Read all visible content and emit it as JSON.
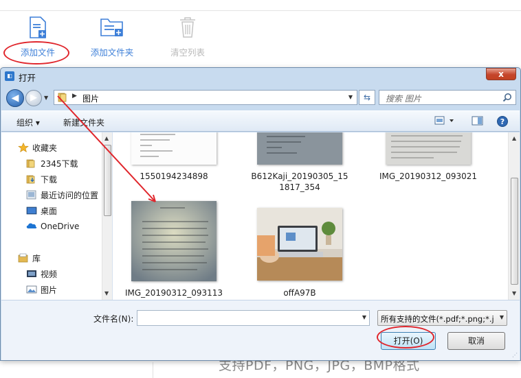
{
  "app": {
    "toolbar": [
      {
        "label": "添加文件",
        "icon": "add-file-icon",
        "enabled": true
      },
      {
        "label": "添加文件夹",
        "icon": "add-folder-icon",
        "enabled": true
      },
      {
        "label": "清空列表",
        "icon": "trash-icon",
        "enabled": false
      }
    ],
    "support_text": "支持PDF，PNG，JPG，BMP格式"
  },
  "dialog": {
    "title": "打开",
    "close_label": "x",
    "breadcrumb": "图片",
    "search_placeholder": "搜索 图片",
    "commands": {
      "organize": "组织 ▾",
      "new_folder": "新建文件夹"
    },
    "nav": {
      "favorites_label": "收藏夹",
      "favorites": [
        "2345下载",
        "下载",
        "最近访问的位置",
        "桌面",
        "OneDrive"
      ],
      "libraries_label": "库",
      "libraries": [
        "视频",
        "图片"
      ]
    },
    "files": [
      {
        "name": "1550194234898"
      },
      {
        "name": "B612Kaji_20190305_15",
        "name2": "1817_354"
      },
      {
        "name": "IMG_20190312_093021"
      },
      {
        "name": "IMG_20190312_093113"
      },
      {
        "name": "offA97B"
      }
    ],
    "filename_label": "文件名(N):",
    "filename_value": "",
    "filetype_value": "所有支持的文件(*.pdf;*.png;*.j",
    "open_button": "打开(O)",
    "cancel_button": "取消"
  },
  "colors": {
    "accent": "#3d7fd8",
    "annotation": "#e0262c",
    "dialog_frame": "#c8dbef"
  }
}
